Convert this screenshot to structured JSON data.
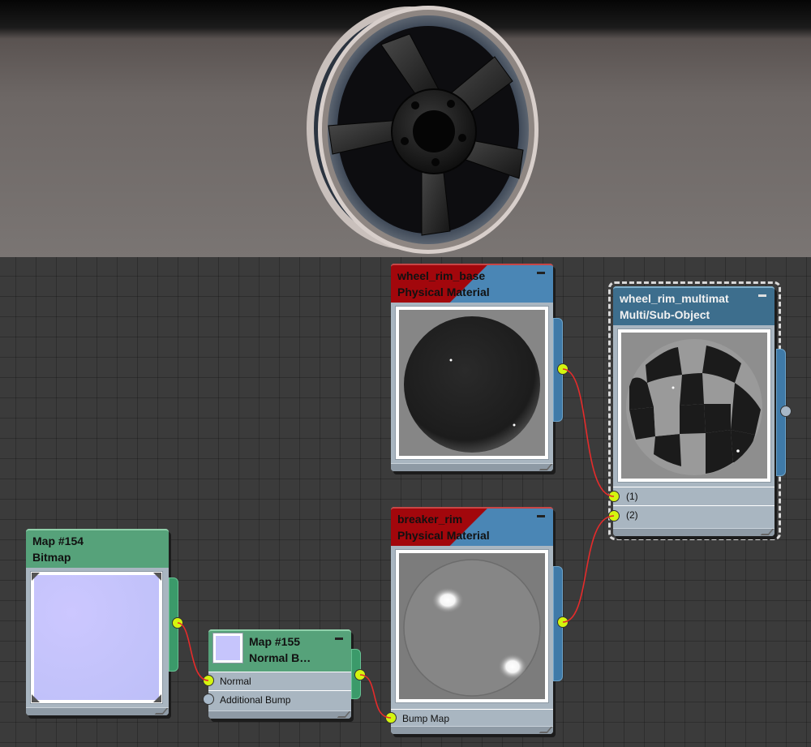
{
  "colors": {
    "material_header_blue": "#3d6e8d",
    "map_header_green": "#56a27a",
    "wire": "#e52b2b",
    "socket_connected": "#d4f50f",
    "socket_empty": "#a7b8c8"
  },
  "viewport": {
    "object": "wheel rim"
  },
  "nodes": {
    "map154": {
      "name": "Map #154",
      "type": "Bitmap",
      "preview": "normal-map-texture"
    },
    "map155": {
      "name": "Map #155",
      "type": "Normal  B…",
      "slots": [
        "Normal",
        "Additional Bump"
      ]
    },
    "wheel_rim_base": {
      "name": "wheel_rim_base",
      "type": "Physical Material",
      "preview": "dark-sphere"
    },
    "breaker_rim": {
      "name": "breaker_rim",
      "type": "Physical Material",
      "slots": [
        "Bump Map"
      ],
      "preview": "grey-sphere"
    },
    "multimat": {
      "name": "wheel_rim_multimat",
      "type": "Multi/Sub-Object",
      "slots": [
        "(1)",
        "(2)"
      ],
      "preview": "checker-sphere"
    }
  },
  "icons": [
    "collapse-icon",
    "input-socket-icon",
    "output-socket-icon",
    "resize-grip-icon"
  ]
}
